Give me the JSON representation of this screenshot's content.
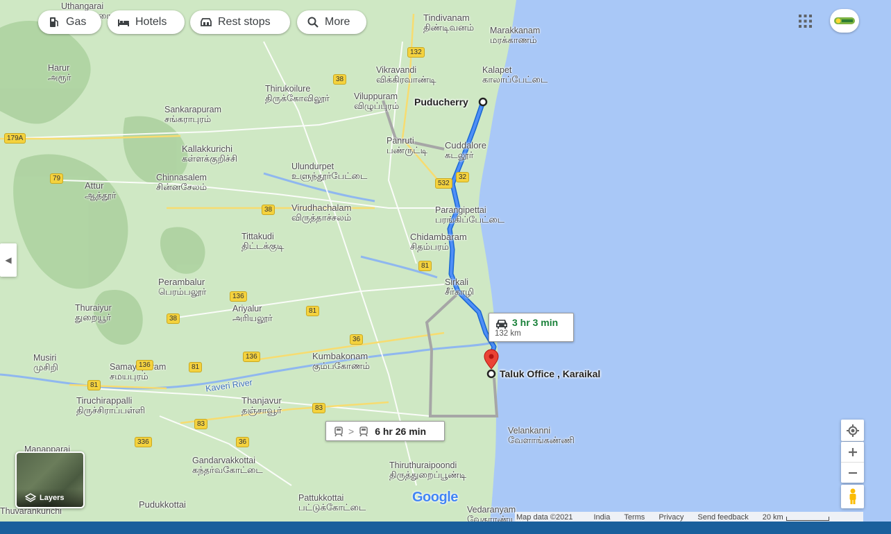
{
  "toolbar": {
    "gas": "Gas",
    "hotels": "Hotels",
    "rest_stops": "Rest stops",
    "more": "More"
  },
  "route": {
    "origin": "Puducherry",
    "destination": "Taluk Office , Karaikal",
    "drive_time": "3 hr 3 min",
    "distance": "132 km",
    "transit_time": "6 hr 26 min"
  },
  "places": [
    {
      "en": "Uthangarai",
      "ta": "ஊத்தங்கரை"
    },
    {
      "en": "Tindivanam",
      "ta": "திண்டிவனம்"
    },
    {
      "en": "Marakkanam",
      "ta": "மரக்காணம்"
    },
    {
      "en": "Harur",
      "ta": "அரூர்"
    },
    {
      "en": "Vikravandi",
      "ta": "விக்கிரவாண்டி"
    },
    {
      "en": "Kalapet",
      "ta": "காலாப்பேட்டை"
    },
    {
      "en": "Thirukoilure",
      "ta": "திருக்கோவிலூர்"
    },
    {
      "en": "Viluppuram",
      "ta": "விழுப்புரம்"
    },
    {
      "en": "Sankarapuram",
      "ta": "சங்கராபுரம்"
    },
    {
      "en": "Panruti",
      "ta": "பண்ருட்டி"
    },
    {
      "en": "Cuddalore",
      "ta": "கடலூர்"
    },
    {
      "en": "Kallakkurichi",
      "ta": "கள்ளக்குறிச்சி"
    },
    {
      "en": "Chinnasalem",
      "ta": "சின்னசேலம்"
    },
    {
      "en": "Ulundurpet",
      "ta": "உளுந்தூர்பேட்டை"
    },
    {
      "en": "Attur",
      "ta": "ஆத்தூர்"
    },
    {
      "en": "Virudhachalam",
      "ta": "விருத்தாச்சலம்"
    },
    {
      "en": "Parangipettai",
      "ta": "பரங்கிப்பேட்டை"
    },
    {
      "en": "Tittakudi",
      "ta": "திட்டக்குடி"
    },
    {
      "en": "Chidambaram",
      "ta": "சிதம்பரம்"
    },
    {
      "en": "Perambalur",
      "ta": "பெரம்பலூர்"
    },
    {
      "en": "Sirkali",
      "ta": "சீர்காழி"
    },
    {
      "en": "Thuraiyur",
      "ta": "துறையூர்"
    },
    {
      "en": "Ariyalur",
      "ta": "அரியலூர்"
    },
    {
      "en": "Musiri",
      "ta": "முசிறி"
    },
    {
      "en": "Samayapuram",
      "ta": "சமயபுரம்"
    },
    {
      "en": "Kumbakonam",
      "ta": "கும்பகோணம்"
    },
    {
      "en": "Tiruchirappalli",
      "ta": "திருச்சிராப்பள்ளி"
    },
    {
      "en": "Thanjavur",
      "ta": "தஞ்சாவூர்"
    },
    {
      "en": "Velankanni",
      "ta": "வேளாங்கண்ணி"
    },
    {
      "en": "Manapparai",
      "ta": ""
    },
    {
      "en": "Gandarvakkottai",
      "ta": "கந்தர்வகோட்டை"
    },
    {
      "en": "Thiruthuraipoondi",
      "ta": "திருத்துறைப்பூண்டி"
    },
    {
      "en": "Pudukkottai",
      "ta": ""
    },
    {
      "en": "Pattukkottai",
      "ta": "பட்டுக்கோட்டை"
    },
    {
      "en": "Vedaranyam",
      "ta": "வேதாரண்யம்"
    },
    {
      "en": "Thuvarankurichi",
      "ta": ""
    }
  ],
  "river_label": "Kaveri River",
  "highways": [
    "132",
    "38",
    "179A",
    "79",
    "532",
    "32",
    "38",
    "81",
    "136",
    "136",
    "38",
    "81",
    "36",
    "136",
    "81",
    "81",
    "83",
    "83",
    "36",
    "336"
  ],
  "layers_label": "Layers",
  "google_logo": "Google",
  "footer": {
    "map_data": "Map data ©2021",
    "country": "India",
    "terms": "Terms",
    "privacy": "Privacy",
    "feedback": "Send feedback",
    "scale": "20 km"
  },
  "colors": {
    "land": "#cfe8c4",
    "sea": "#a9c8f7",
    "route": "#4285f4",
    "alt_route": "#a6a6a6",
    "drive_time": "#188038",
    "destination_pin": "#ea4335"
  }
}
